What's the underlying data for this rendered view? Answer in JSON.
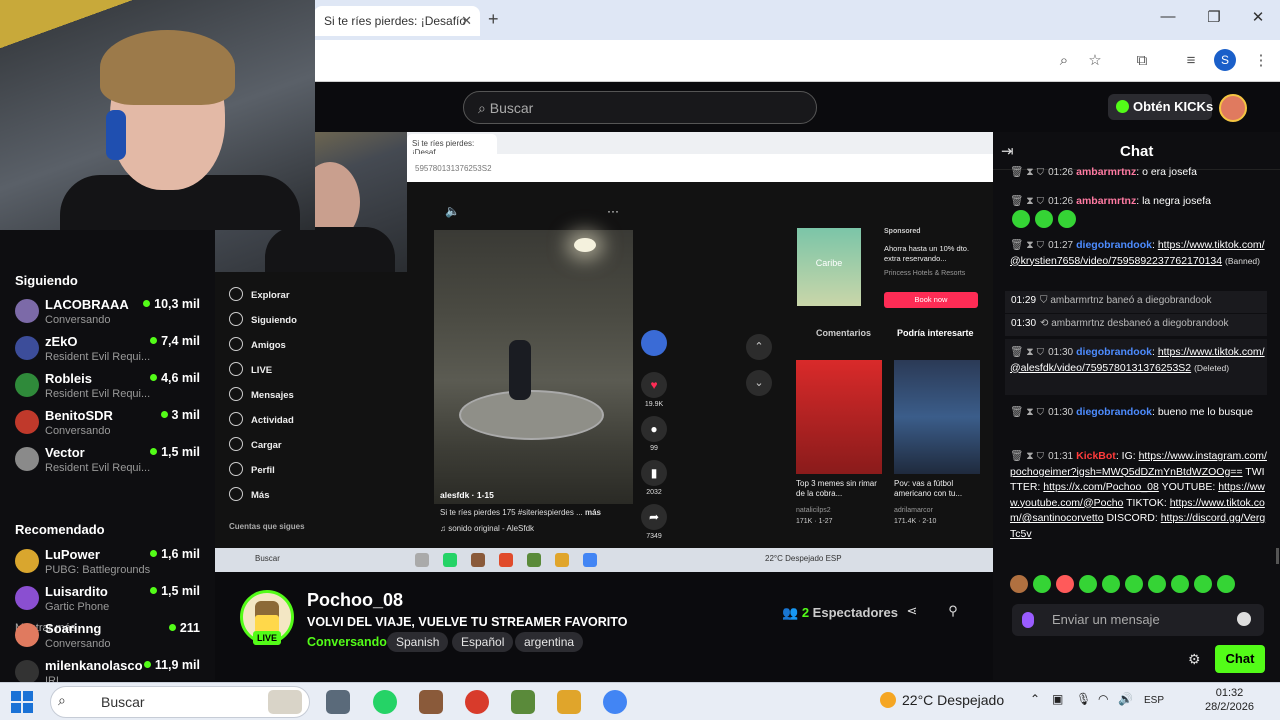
{
  "browser": {
    "tab_title": "Si te ríes pierdes: ¡Desafío",
    "new_tab": "+",
    "profile_initial": "S"
  },
  "header": {
    "search_placeholder": "Buscar",
    "kicks_label": "Obtén KICKs"
  },
  "sidebar": {
    "following_title": "Siguiendo",
    "following": [
      {
        "name": "LACOBRAAA",
        "sub": "Conversando",
        "viewers": "10,3 mil"
      },
      {
        "name": "zEkO",
        "sub": "Resident Evil Requi...",
        "viewers": "7,4 mil"
      },
      {
        "name": "Robleis",
        "sub": "Resident Evil Requi...",
        "viewers": "4,6 mil"
      },
      {
        "name": "BenitoSDR",
        "sub": "Conversando",
        "viewers": "3 mil"
      },
      {
        "name": "Vector",
        "sub": "Resident Evil Requi...",
        "viewers": "1,5 mil"
      }
    ],
    "show_more": "Mostrar más",
    "recommended_title": "Recomendado",
    "recommended": [
      {
        "name": "LuPower",
        "sub": "PUBG: Battlegrounds",
        "viewers": "1,6 mil"
      },
      {
        "name": "Luisardito",
        "sub": "Gartic Phone",
        "viewers": "1,5 mil"
      },
      {
        "name": "Soarinng",
        "sub": "Conversando",
        "viewers": "211"
      },
      {
        "name": "milenkanolasco",
        "sub": "IRL",
        "viewers": "11,9 mil"
      }
    ]
  },
  "inner_screen": {
    "tab": "Si te ríes pierdes: ¡Desaf",
    "address": "595780131376253S2",
    "menu": [
      "Explorar",
      "Siguiendo",
      "Amigos",
      "LIVE",
      "Mensajes",
      "Actividad",
      "Cargar",
      "Perfil",
      "Más"
    ],
    "accounts_label": "Cuentas que sigues",
    "video_author": "alesfdk · 1-15",
    "video_caption": "Si te ríes pierdes 175 #siteriespierdes ...",
    "video_more": "más",
    "video_sound": "♫ sonido original - AleSfdk",
    "likes": "19.9K",
    "comments": "99",
    "saves": "2032",
    "shares": "7349",
    "ad_label": "Sponsored",
    "ad_title": "Ahorra hasta un 10% dto. extra reservando...",
    "ad_brand": "Princess Hotels & Resorts",
    "ad_button": "Book now",
    "ad_image_text": "Caribe",
    "tab_comments": "Comentarios",
    "tab_might_like": "Podría interesarte",
    "thumbs": [
      {
        "caption": "Top 3 memes sin rimar de la cobra...",
        "author": "natalicilps2",
        "views": "171K · 1-27"
      },
      {
        "caption": "Pov: vas a fútbol americano con tu...",
        "author": "adrilamarcor",
        "views": "171.4K · 2-10"
      }
    ],
    "win_search": "Buscar",
    "win_weather": "22°C Despejado   ESP"
  },
  "stream": {
    "channel": "Pochoo_08",
    "live": "LIVE",
    "title": "VOLVI DEL VIAJE, VUELVE TU STREAMER FAVORITO",
    "category": "Conversando",
    "tags": [
      "Spanish",
      "Español",
      "argentina"
    ],
    "viewer_count": "2",
    "viewer_label": "Espectadores"
  },
  "chat": {
    "title": "Chat",
    "messages": [
      {
        "time": "01:26",
        "user": "ambarmrtnz",
        "text": "o era josefa"
      },
      {
        "time": "01:26",
        "user": "ambarmrtnz",
        "text": "la negra josefa"
      },
      {
        "time": "01:27",
        "user": "diegobrandook",
        "text": "https://www.tiktok.com/@krystien7658/video/7595892237762170134",
        "status": "(Banned)"
      },
      {
        "time": "01:29",
        "user": "ambarmrtnz",
        "text": "baneó a diegobrandook"
      },
      {
        "time": "01:30",
        "user": "ambarmrtnz",
        "text": "desbaneó a diegobrandook"
      },
      {
        "time": "01:30",
        "user": "diegobrandook",
        "text": "https://www.tiktok.com/@alesfdk/video/7595780131376253S2",
        "status": "(Deleted)"
      },
      {
        "time": "01:30",
        "user": "diegobrandook",
        "text": "bueno me lo busque"
      },
      {
        "time": "01:31",
        "user": "KickBot",
        "text_prefix": "IG:",
        "ig": "https://www.instagram.com/pochogeimer?igsh=MWQ5dDZmYnBtdWZOOg==",
        "twitter_label": "TWITTER:",
        "twitter": "https://x.com/Pochoo_08",
        "youtube_label": "YOUTUBE:",
        "youtube": "https://www.youtube.com/@Pocho",
        "tiktok_label": "TIKTOK:",
        "tiktok": "https://www.tiktok.com/@santinocorvetto",
        "discord_label": "DISCORD:",
        "discord": "https://discord.gg/VergTc5v"
      }
    ],
    "input_placeholder": "Enviar un mensaje",
    "send_label": "Chat"
  },
  "taskbar": {
    "search": "Buscar",
    "weather": "22°C  Despejado",
    "lang": "ESP",
    "time": "01:32",
    "date": "28/2/2026"
  }
}
